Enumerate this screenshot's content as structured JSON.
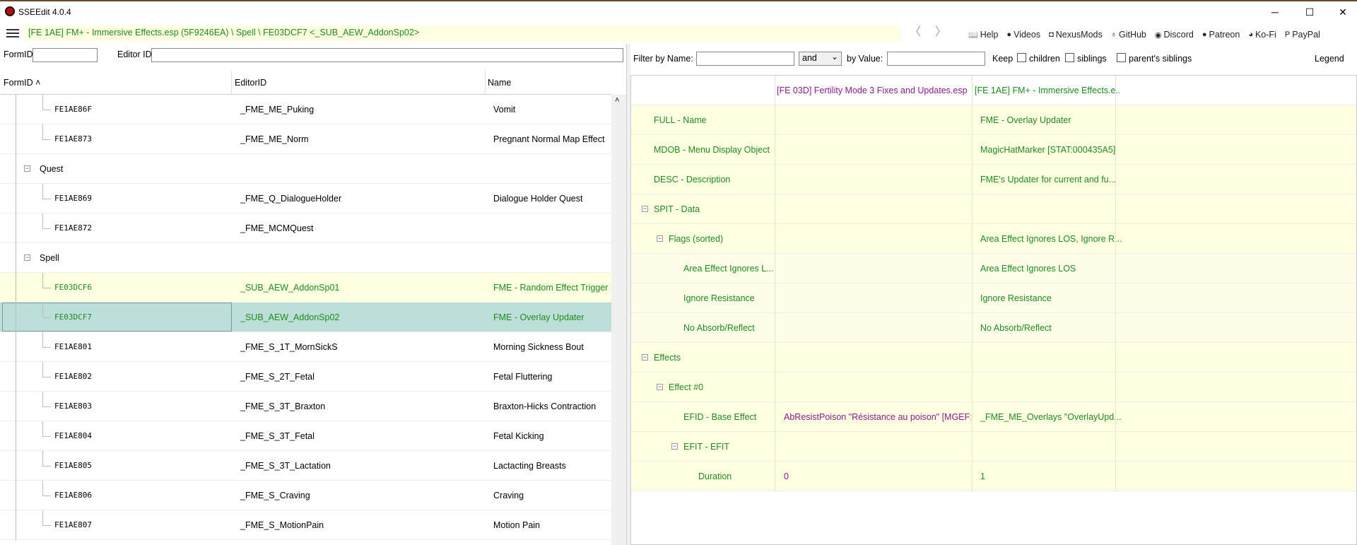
{
  "window": {
    "title": "SSEEdit 4.0.4",
    "minimize": "─",
    "maximize": "☐",
    "close": "✕"
  },
  "address": {
    "path": "[FE 1AE] FM+ - Immersive Effects.esp (5F9246EA) \\ Spell \\ FE03DCF7 <_SUB_AEW_AddonSp02>",
    "back": "〈",
    "forward": "〉"
  },
  "toolbar_links": [
    {
      "icon": "📖",
      "label": "Help"
    },
    {
      "icon": "●",
      "label": "Videos"
    },
    {
      "icon": "◘",
      "label": "NexusMods"
    },
    {
      "icon": "♁",
      "label": "GitHub"
    },
    {
      "icon": "◉",
      "label": "Discord"
    },
    {
      "icon": "●",
      "label": "Patreon"
    },
    {
      "icon": "◕",
      "label": "Ko-Fi"
    },
    {
      "icon": "P",
      "label": "PayPal"
    }
  ],
  "left_filter": {
    "formid_label": "FormID",
    "editorid_label": "Editor ID"
  },
  "left_grid": {
    "headers": {
      "formid": "FormID ˄",
      "editorid": "EditorID",
      "name": "Name"
    },
    "rows": [
      {
        "fid": "FE1AE86F",
        "eid": "_FME_ME_Puking",
        "nm": "Vomit"
      },
      {
        "fid": "FE1AE873",
        "eid": "_FME_ME_Norm",
        "nm": "Pregnant Normal Map Effect"
      },
      {
        "group": "Quest"
      },
      {
        "fid": "FE1AE869",
        "eid": "_FME_Q_DialogueHolder",
        "nm": "Dialogue Holder Quest"
      },
      {
        "fid": "FE1AE872",
        "eid": "_FME_MCMQuest",
        "nm": ""
      },
      {
        "group": "Spell"
      },
      {
        "fid": "FE03DCF6",
        "eid": "_SUB_AEW_AddonSp01",
        "nm": "FME - Random Effect Trigger"
      },
      {
        "fid": "FE03DCF7",
        "eid": "_SUB_AEW_AddonSp02",
        "nm": "FME - Overlay Updater"
      },
      {
        "fid": "FE1AE801",
        "eid": "_FME_S_1T_MornSickS",
        "nm": "Morning Sickness Bout"
      },
      {
        "fid": "FE1AE802",
        "eid": "_FME_S_2T_Fetal",
        "nm": "Fetal Fluttering"
      },
      {
        "fid": "FE1AE803",
        "eid": "_FME_S_3T_Braxton",
        "nm": "Braxton-Hicks Contraction"
      },
      {
        "fid": "FE1AE804",
        "eid": "_FME_S_3T_Fetal",
        "nm": "Fetal Kicking"
      },
      {
        "fid": "FE1AE805",
        "eid": "_FME_S_3T_Lactation",
        "nm": "Lactacting Breasts"
      },
      {
        "fid": "FE1AE806",
        "eid": "_FME_S_Craving",
        "nm": "Craving"
      },
      {
        "fid": "FE1AE807",
        "eid": "_FME_S_MotionPain",
        "nm": "Motion Pain"
      }
    ]
  },
  "right_filter": {
    "name_label": "Filter by Name:",
    "and_value": "and",
    "value_label": "by Value:",
    "keep_label": "Keep",
    "children": "children",
    "siblings": "siblings",
    "parents_siblings": "parent's siblings",
    "legend": "Legend"
  },
  "right_grid": {
    "col1_header": "[FE 03D] Fertility Mode 3 Fixes and Updates.esp",
    "col2_header": "[FE 1AE] FM+ - Immersive Effects.e...",
    "rows": [
      {
        "label": "FULL - Name",
        "v1": "",
        "v2": "FME - Overlay Updater"
      },
      {
        "label": "MDOB - Menu Display Object",
        "v1": "",
        "v2": "MagicHatMarker [STAT:000435A5]"
      },
      {
        "label": "DESC - Description",
        "v1": "",
        "v2": "FME's Updater for current and fu..."
      },
      {
        "label": "SPIT - Data",
        "v1": "",
        "v2": ""
      },
      {
        "label": "Flags (sorted)",
        "v1": "",
        "v2": "Area Effect Ignores LOS, Ignore R..."
      },
      {
        "label": "Area Effect Ignores L...",
        "v1": "",
        "v2": "Area Effect Ignores LOS"
      },
      {
        "label": "Ignore Resistance",
        "v1": "",
        "v2": "Ignore Resistance"
      },
      {
        "label": "No Absorb/Reflect",
        "v1": "",
        "v2": "No Absorb/Reflect"
      },
      {
        "label": "Effects",
        "v1": "",
        "v2": ""
      },
      {
        "label": "Effect #0",
        "v1": "",
        "v2": ""
      },
      {
        "label": "EFID - Base Effect",
        "v1": "AbResistPoison \"Résistance au poison\" [MGEF:...",
        "v2": "_FME_ME_Overlays \"OverlayUpd..."
      },
      {
        "label": "EFIT - EFIT",
        "v1": "",
        "v2": ""
      },
      {
        "label": "Duration",
        "v1": "0",
        "v2": "1"
      }
    ]
  },
  "expander_symbol": "−"
}
